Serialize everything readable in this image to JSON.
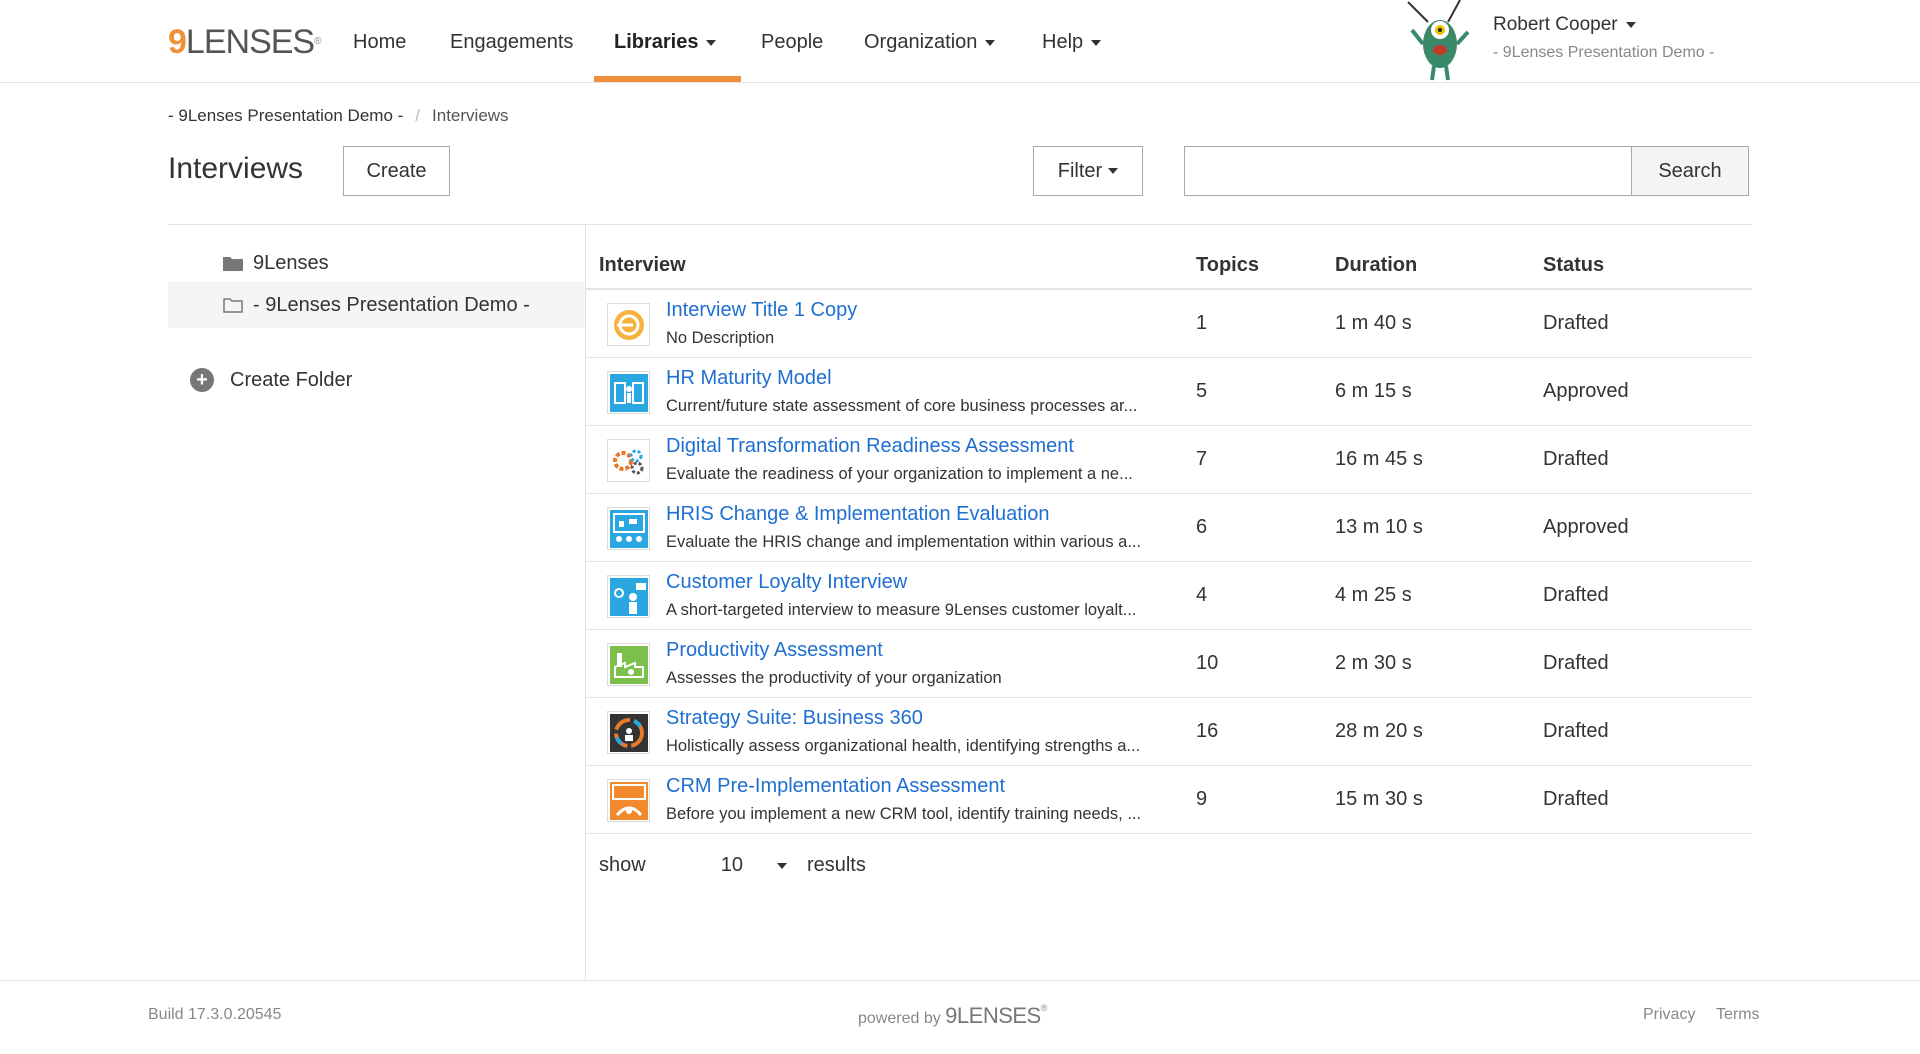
{
  "brand": {
    "nine": "9",
    "lenses": "LENSES",
    "reg": "®"
  },
  "nav": {
    "home": "Home",
    "engagements": "Engagements",
    "libraries": "Libraries",
    "people": "People",
    "organization": "Organization",
    "help": "Help"
  },
  "user": {
    "name": "Robert Cooper",
    "org": "- 9Lenses Presentation Demo -"
  },
  "breadcrumb": {
    "root": "- 9Lenses Presentation Demo -",
    "separator": "/",
    "current": "Interviews"
  },
  "header": {
    "title": "Interviews",
    "create_label": "Create",
    "filter_label": "Filter",
    "search_placeholder": "",
    "search_label": "Search"
  },
  "sidebar": {
    "folders": [
      {
        "label": "9Lenses"
      },
      {
        "label": "- 9Lenses Presentation Demo -"
      }
    ],
    "create_folder_label": "Create Folder"
  },
  "table": {
    "columns": {
      "interview": "Interview",
      "topics": "Topics",
      "duration": "Duration",
      "status": "Status"
    },
    "rows": [
      {
        "title": "Interview Title 1 Copy",
        "desc": "No Description",
        "topics": "1",
        "duration": "1 m 40 s",
        "status": "Drafted",
        "icon": "orange-swirl-icon"
      },
      {
        "title": "HR Maturity Model",
        "desc": "Current/future state assessment of core business processes ar...",
        "topics": "5",
        "duration": "6 m 15 s",
        "status": "Approved",
        "icon": "hr-people-icon"
      },
      {
        "title": "Digital Transformation Readiness Assessment",
        "desc": "Evaluate the readiness of your organization to implement a ne...",
        "topics": "7",
        "duration": "16 m 45 s",
        "status": "Drafted",
        "icon": "gears-icon"
      },
      {
        "title": "HRIS Change & Implementation Evaluation",
        "desc": "Evaluate the HRIS change and implementation within various a...",
        "topics": "6",
        "duration": "13 m 10 s",
        "status": "Approved",
        "icon": "presentation-board-icon"
      },
      {
        "title": "Customer Loyalty Interview",
        "desc": "A short-targeted interview to measure 9Lenses customer loyalt...",
        "topics": "4",
        "duration": "4 m 25 s",
        "status": "Drafted",
        "icon": "customer-speech-icon"
      },
      {
        "title": "Productivity Assessment",
        "desc": "Assesses the productivity of your organization",
        "topics": "10",
        "duration": "2 m 30 s",
        "status": "Drafted",
        "icon": "factory-icon"
      },
      {
        "title": "Strategy Suite: Business 360",
        "desc": "Holistically assess organizational health, identifying strengths a...",
        "topics": "16",
        "duration": "28 m 20 s",
        "status": "Drafted",
        "icon": "business-360-icon"
      },
      {
        "title": "CRM Pre-Implementation Assessment",
        "desc": "Before you implement a new CRM tool, identify training needs, ...",
        "topics": "9",
        "duration": "15 m 30 s",
        "status": "Drafted",
        "icon": "crm-icon"
      }
    ]
  },
  "pager": {
    "show_label": "show",
    "page_size": "10",
    "results_label": "results"
  },
  "footer": {
    "build": "Build 17.3.0.20545",
    "powered_by": "powered by",
    "powered_brand": "9LENSES",
    "privacy": "Privacy",
    "terms": "Terms"
  },
  "colors": {
    "accent": "#f0903a",
    "link": "#1f6fd1",
    "border": "#e3e3e3"
  }
}
